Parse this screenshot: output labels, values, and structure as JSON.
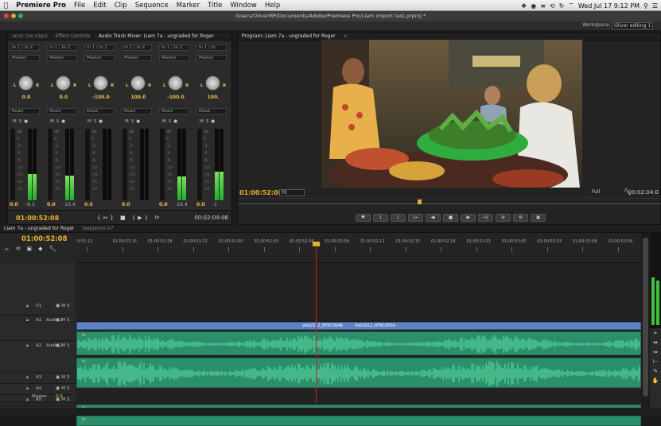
{
  "menubar": {
    "app": "Premiere Pro",
    "items": [
      "File",
      "Edit",
      "Clip",
      "Sequence",
      "Marker",
      "Title",
      "Window",
      "Help"
    ],
    "clock": "Wed Jul 17  9:12 PM"
  },
  "window": {
    "path": "/Users/OliverMP/Documents/Adobe/Premiere Pro/Liam import test.prproj *"
  },
  "workspace": {
    "label": "Workspace:",
    "value": "Oliver editing 1"
  },
  "mixer": {
    "tabs": [
      "urce: (no clips)",
      "Effect Controls",
      "Audio Track Mixer: Liam 7a - ungraded for Roger"
    ],
    "strips": [
      {
        "input": "In 1 / In 2",
        "output": "Master",
        "pan": "0.0",
        "read": "Read",
        "vol": "0.0",
        "volr": "-9.3",
        "num": "A1",
        "name": "Audio 1",
        "level": 0.55
      },
      {
        "input": "In 1 / In 2",
        "output": "Master",
        "pan": "0.0",
        "read": "Read",
        "vol": "0.0",
        "volr": "-10.4",
        "num": "A2",
        "name": "Audio 2",
        "level": 0.52
      },
      {
        "input": "In 1 / In 2",
        "output": "Master",
        "pan": "-100.0",
        "read": "Read",
        "vol": "0.0",
        "volr": "",
        "num": "A3",
        "name": "Audio 3",
        "level": 0
      },
      {
        "input": "In 1 / In 2",
        "output": "Master",
        "pan": "100.0",
        "read": "Read",
        "vol": "0.0",
        "volr": "",
        "num": "A4",
        "name": "Audio 4",
        "level": 0
      },
      {
        "input": "In 1 / In 2",
        "output": "Master",
        "pan": "-100.0",
        "read": "Read",
        "vol": "0.0",
        "volr": "-19.4",
        "num": "A5",
        "name": "Audio 5",
        "level": 0.5
      },
      {
        "input": "In 1 / In",
        "output": "Master",
        "pan": "100.",
        "read": "Read",
        "vol": "0.0",
        "volr": "-1",
        "num": "A6",
        "name": "Aud",
        "level": 0.6
      }
    ],
    "timecode": "01:00:52:08",
    "duration": "00:02:04:06"
  },
  "program": {
    "tab": "Program: Liam 7a - ungraded for Roger",
    "timecode": "01:00:52:08",
    "fit": "Fit",
    "full": "Full",
    "duration": "00:02:04:0",
    "buttons": [
      "♥",
      "{",
      "}",
      "{←",
      "◀I",
      "■",
      "I▶",
      "→}",
      "⊕",
      "⊗",
      "▣"
    ]
  },
  "timeline": {
    "tabs": [
      "Liam 7a - ungraded for Roger",
      "Sequence 07"
    ],
    "timecode": "01:00:52:08",
    "ruler": [
      "0:51:12",
      "01:00:51:15",
      "01:00:51:18",
      "01:00:51:21",
      "01:00:52:00",
      "01:00:52:03",
      "01:00:52:06",
      "01:00:52:09",
      "01:00:52:12",
      "01:00:52:15",
      "01:00:52:18",
      "01:00:52:21",
      "01:00:53:00",
      "01:00:53:03",
      "01:00:53:06",
      "01:00:53:09",
      "01"
    ],
    "tracks": [
      {
        "id": "V1",
        "name": ""
      },
      {
        "id": "A1",
        "name": "Audio 1"
      },
      {
        "id": "A2",
        "name": "Audio 2"
      },
      {
        "id": "A3",
        "name": ""
      },
      {
        "id": "A4",
        "name": ""
      },
      {
        "id": "A5",
        "name": ""
      },
      {
        "id": "A6",
        "name": ""
      }
    ],
    "master": {
      "label": "Master",
      "value": "0.0"
    },
    "clips": [
      "Viet2012_RF8C0648",
      "Viet2012_RF8C0656"
    ]
  },
  "colors": {
    "timecode": "#f0b42c",
    "video_clip": "#5f82c0",
    "audio_clip": "#2b8f6c",
    "playhead": "#d02525"
  }
}
